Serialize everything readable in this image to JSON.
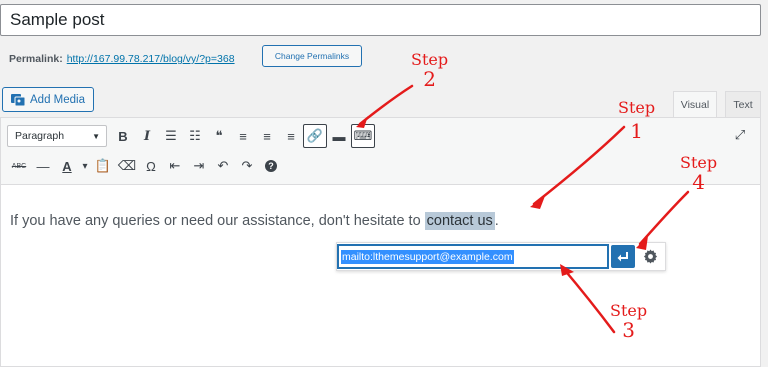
{
  "post_title": "Sample post",
  "permalink": {
    "label": "Permalink:",
    "url": "http://167.99.78.217/blog/vy/?p=368",
    "change_button": "Change Permalinks"
  },
  "add_media_label": "Add Media",
  "editor_tabs": {
    "visual": "Visual",
    "text": "Text"
  },
  "format_select": "Paragraph",
  "toolbar_row1": [
    {
      "name": "bold-button",
      "glyph": "B",
      "icon": "bold-icon"
    },
    {
      "name": "italic-button",
      "glyph": "I",
      "icon": "italic-icon"
    },
    {
      "name": "bullet-list-button",
      "glyph": "☰",
      "icon": "bullet-list-icon"
    },
    {
      "name": "numbered-list-button",
      "glyph": "☷",
      "icon": "numbered-list-icon"
    },
    {
      "name": "blockquote-button",
      "glyph": "❝",
      "icon": "quote-icon"
    },
    {
      "name": "align-left-button",
      "glyph": "≡",
      "icon": "align-left-icon"
    },
    {
      "name": "align-center-button",
      "glyph": "≡",
      "icon": "align-center-icon"
    },
    {
      "name": "align-right-button",
      "glyph": "≡",
      "icon": "align-right-icon"
    },
    {
      "name": "insert-link-button",
      "glyph": "🔗",
      "icon": "link-icon",
      "active": true
    },
    {
      "name": "read-more-button",
      "glyph": "▬",
      "icon": "read-more-icon"
    },
    {
      "name": "toolbar-toggle-button",
      "glyph": "⌨",
      "icon": "keyboard-icon",
      "active": true
    }
  ],
  "toolbar_row2": [
    {
      "name": "strikethrough-button",
      "glyph": "ABC",
      "icon": "strikethrough-icon"
    },
    {
      "name": "horizontal-line-button",
      "glyph": "—",
      "icon": "horizontal-line-icon"
    },
    {
      "name": "text-color-button",
      "glyph": "A",
      "icon": "text-color-icon"
    },
    {
      "name": "text-color-dropdown",
      "glyph": "▾",
      "icon": "chevron-down-icon"
    },
    {
      "name": "paste-text-button",
      "glyph": "📋",
      "icon": "clipboard-icon"
    },
    {
      "name": "clear-formatting-button",
      "glyph": "⌫",
      "icon": "eraser-icon"
    },
    {
      "name": "special-character-button",
      "glyph": "Ω",
      "icon": "omega-icon"
    },
    {
      "name": "outdent-button",
      "glyph": "⇤",
      "icon": "outdent-icon"
    },
    {
      "name": "indent-button",
      "glyph": "⇥",
      "icon": "indent-icon"
    },
    {
      "name": "undo-button",
      "glyph": "↶",
      "icon": "undo-icon"
    },
    {
      "name": "redo-button",
      "glyph": "↷",
      "icon": "redo-icon"
    },
    {
      "name": "help-button",
      "glyph": "?",
      "icon": "help-icon"
    }
  ],
  "content": {
    "before": "If you have any queries or need our assistance,  don't hesitate to ",
    "selected": "contact us",
    "after": "."
  },
  "link_input_value": "mailto:lthemesupport@example.com",
  "annotations": [
    {
      "word": "Step",
      "number": "2"
    },
    {
      "word": "Step",
      "number": "1"
    },
    {
      "word": "Step",
      "number": "4"
    },
    {
      "word": "Step",
      "number": "3"
    }
  ],
  "colors": {
    "annotation": "#e41b1b",
    "accent": "#2271b1",
    "selection": "#b8c9d8"
  }
}
